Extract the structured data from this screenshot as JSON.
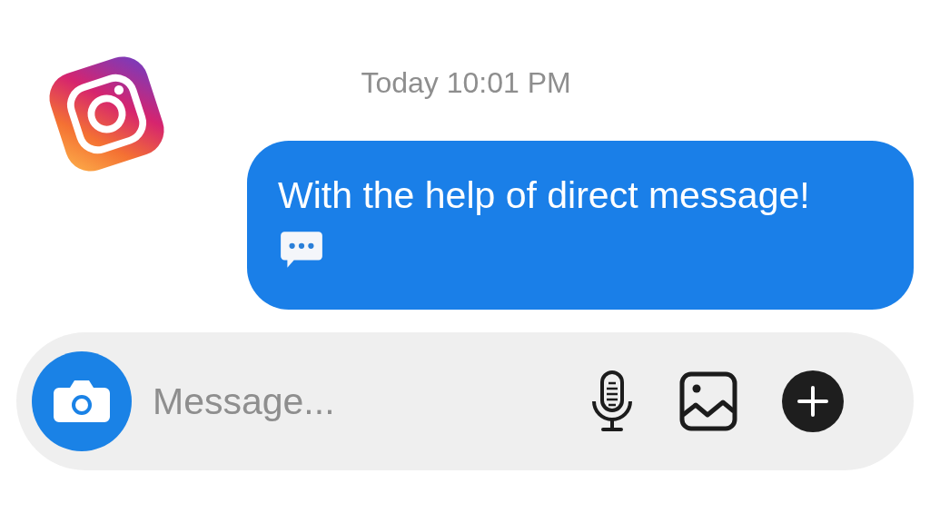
{
  "timestamp": "Today 10:01 PM",
  "messages": [
    {
      "kind": "outgoing",
      "text": "With the help of direct message!"
    }
  ],
  "composer": {
    "placeholder": "Message..."
  }
}
